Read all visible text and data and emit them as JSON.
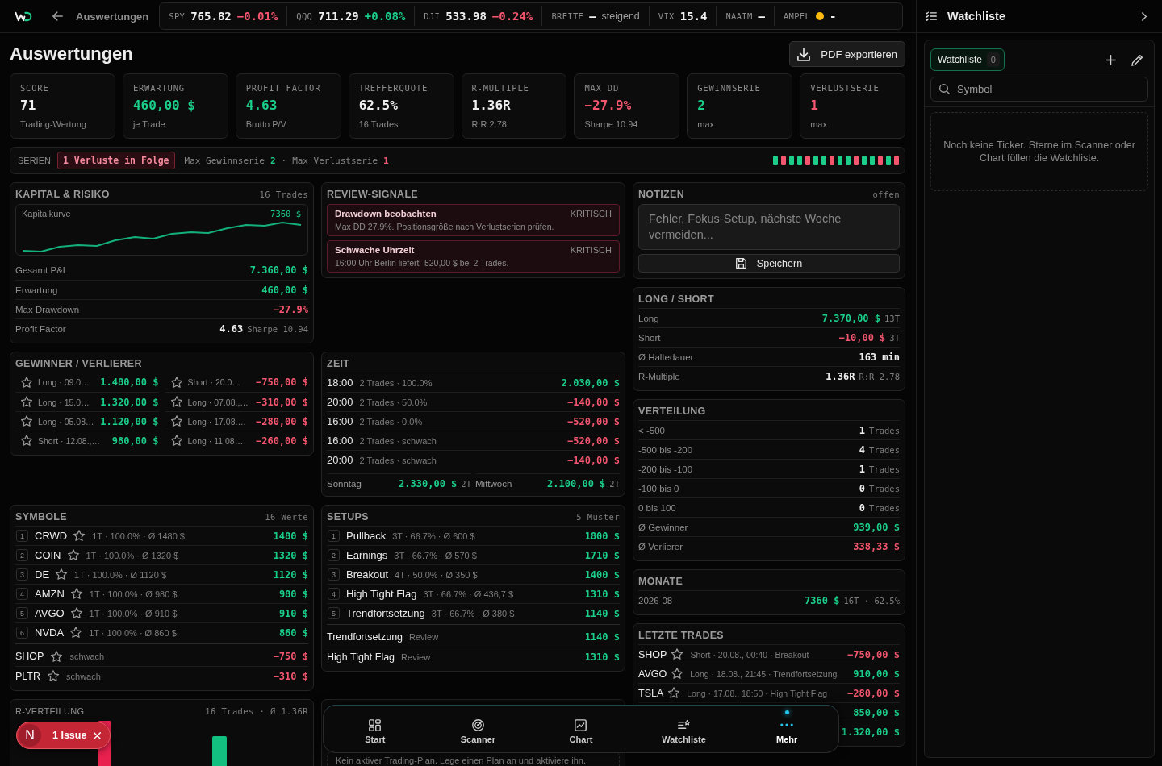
{
  "topbar": {
    "back_label": "Auswertungen",
    "tickers": [
      {
        "symbol": "SPY",
        "price": "765.82",
        "change": "−0.01%",
        "color": "#f5566f"
      },
      {
        "symbol": "QQQ",
        "price": "711.29",
        "change": "+0.08%",
        "color": "#1bcf8b"
      },
      {
        "symbol": "DJI",
        "price": "533.98",
        "change": "−0.24%",
        "color": "#f5566f"
      }
    ],
    "indicators": [
      {
        "label": "BREITE",
        "value": "–",
        "note": "steigend"
      },
      {
        "label": "VIX",
        "value": "15.4"
      },
      {
        "label": "NAAIM",
        "value": "–"
      },
      {
        "label": "AMPEL",
        "color": "#fdbb10",
        "value": "-"
      }
    ]
  },
  "header": {
    "title": "Auswertungen",
    "export_button": "PDF exportieren"
  },
  "kpis": [
    {
      "label": "SCORE",
      "value": "71",
      "color": "#eeeeee",
      "caption": "Trading-Wertung"
    },
    {
      "label": "ERWARTUNG",
      "value": "460,00 $",
      "color": "#1bcf8b",
      "caption": "je Trade"
    },
    {
      "label": "PROFIT FACTOR",
      "value": "4.63",
      "color": "#1bcf8b",
      "caption": "Brutto P/V"
    },
    {
      "label": "TREFFERQUOTE",
      "value": "62.5%",
      "color": "#eeeeee",
      "caption": "16 Trades"
    },
    {
      "label": "R-MULTIPLE",
      "value": "1.36R",
      "color": "#eeeeee",
      "caption": "R:R 2.78"
    },
    {
      "label": "MAX DD",
      "value": "−27.9%",
      "color": "#f5566f",
      "caption": "Sharpe 10.94"
    },
    {
      "label": "GEWINNSERIE",
      "value": "2",
      "color": "#1bcf8b",
      "caption": "max"
    },
    {
      "label": "VERLUSTSERIE",
      "value": "1",
      "color": "#f5566f",
      "caption": "max"
    }
  ],
  "series": {
    "label": "SERIEN",
    "badge": "1 Verluste in Folge",
    "stats": [
      {
        "label": "Max Gewinnserie",
        "value": "2",
        "color": "#1bcf8b"
      },
      {
        "label": "Max Verlustserie",
        "value": "1",
        "color": "#f5566f"
      }
    ],
    "separator": "·",
    "results": [
      {
        "color": "#1bcf8b"
      },
      {
        "color": "#f5566f"
      },
      {
        "color": "#1bcf8b"
      },
      {
        "color": "#1bcf8b"
      },
      {
        "color": "#f5566f"
      },
      {
        "color": "#1bcf8b"
      },
      {
        "color": "#1bcf8b"
      },
      {
        "color": "#f5566f"
      },
      {
        "color": "#1bcf8b"
      },
      {
        "color": "#1bcf8b"
      },
      {
        "color": "#f5566f"
      },
      {
        "color": "#1bcf8b"
      },
      {
        "color": "#1bcf8b"
      },
      {
        "color": "#f5566f"
      },
      {
        "color": "#1bcf8b"
      },
      {
        "color": "#f5566f"
      }
    ]
  },
  "capital": {
    "title": "KAPITAL & RISIKO",
    "meta": "16 Trades",
    "curve": {
      "label": "Kapitalkurve",
      "value": "7360 $"
    },
    "rows": [
      {
        "label": "Gesamt P&L",
        "value": "7.360,00 $",
        "color": "#1bcf8b"
      },
      {
        "label": "Erwartung",
        "value": "460,00 $",
        "color": "#1bcf8b"
      },
      {
        "label": "Max Drawdown",
        "value": "−27.9%",
        "color": "#f5566f"
      },
      {
        "label": "Profit Factor",
        "value": "4.63",
        "color": "#eeeeee",
        "note": "Sharpe 10.94"
      }
    ]
  },
  "review": {
    "title": "REVIEW-SIGNALE",
    "signals": [
      {
        "title": "Drawdown beobachten",
        "severity_label": "KRITISCH",
        "text": "Max DD 27.9%. Positionsgröße nach Verlustserien prüfen."
      },
      {
        "title": "Schwache Uhrzeit",
        "severity_label": "KRITISCH",
        "text": "16:00 Uhr Berlin liefert -520,00 $ bei 2 Trades."
      }
    ]
  },
  "notes": {
    "title": "NOTIZEN",
    "status": "offen",
    "placeholder": "Fehler, Fokus-Setup, nächste Woche vermeiden...",
    "save_button": "Speichern"
  },
  "long_short": {
    "title": "LONG / SHORT",
    "rows": [
      {
        "label": "Long",
        "value": "7.370,00 $",
        "color": "#1bcf8b",
        "note": "13T"
      },
      {
        "label": "Short",
        "value": "−10,00 $",
        "color": "#f5566f",
        "note": "3T"
      },
      {
        "label": "Ø Haltedauer",
        "value": "163 min",
        "color": "#eeeeee"
      },
      {
        "label": "R-Multiple",
        "value": "1.36R",
        "color": "#eeeeee",
        "note": "R:R 2.78"
      }
    ]
  },
  "winners_losers": {
    "title": "GEWINNER / VERLIERER",
    "winners": [
      {
        "detail": "Long · 09.0…",
        "value": "1.480,00 $",
        "color": "#1bcf8b"
      },
      {
        "detail": "Long · 15.0…",
        "value": "1.320,00 $",
        "color": "#1bcf8b"
      },
      {
        "detail": "Long · 05.08…",
        "value": "1.120,00 $",
        "color": "#1bcf8b"
      },
      {
        "detail": "Short · 12.08.,…",
        "value": "980,00 $",
        "color": "#1bcf8b"
      }
    ],
    "losers": [
      {
        "detail": "Short · 20.0…",
        "value": "−750,00 $",
        "color": "#f5566f"
      },
      {
        "detail": "Long · 07.08.,…",
        "value": "−310,00 $",
        "color": "#f5566f"
      },
      {
        "detail": "Long · 17.08.…",
        "value": "−280,00 $",
        "color": "#f5566f"
      },
      {
        "detail": "Long · 11.08…",
        "value": "−260,00 $",
        "color": "#f5566f"
      }
    ]
  },
  "time": {
    "title": "ZEIT",
    "rows": [
      {
        "time": "18:00",
        "detail": "2 Trades · 100.0%",
        "value": "2.030,00 $",
        "color": "#1bcf8b"
      },
      {
        "time": "20:00",
        "detail": "2 Trades · 50.0%",
        "value": "−140,00 $",
        "color": "#f5566f"
      },
      {
        "time": "16:00",
        "detail": "2 Trades · 0.0%",
        "value": "−520,00 $",
        "color": "#f5566f"
      },
      {
        "time": "16:00",
        "detail": "2 Trades · schwach",
        "value": "−520,00 $",
        "color": "#f5566f"
      },
      {
        "time": "20:00",
        "detail": "2 Trades · schwach",
        "value": "−140,00 $",
        "color": "#f5566f"
      }
    ],
    "weekdays": [
      {
        "day": "Sonntag",
        "value": "2.330,00 $",
        "color": "#1bcf8b",
        "count": "2T"
      },
      {
        "day": "Mittwoch",
        "value": "2.100,00 $",
        "color": "#1bcf8b",
        "count": "2T"
      }
    ]
  },
  "distribution": {
    "title": "VERTEILUNG",
    "rows": [
      {
        "label": "< -500",
        "value": "1",
        "color": "#eeeeee",
        "note": "Trades"
      },
      {
        "label": "-500 bis -200",
        "value": "4",
        "color": "#eeeeee",
        "note": "Trades"
      },
      {
        "label": "-200 bis -100",
        "value": "1",
        "color": "#eeeeee",
        "note": "Trades"
      },
      {
        "label": "-100 bis 0",
        "value": "0",
        "color": "#eeeeee",
        "note": "Trades"
      },
      {
        "label": "0 bis 100",
        "value": "0",
        "color": "#eeeeee",
        "note": "Trades"
      },
      {
        "label": "Ø Gewinner",
        "value": "939,00 $",
        "color": "#1bcf8b"
      },
      {
        "label": "Ø Verlierer",
        "value": "338,33 $",
        "color": "#f5566f"
      }
    ]
  },
  "months": {
    "title": "MONATE",
    "rows": [
      {
        "label": "2026-08",
        "value": "7360 $",
        "color": "#1bcf8b",
        "note": "16T · 62.5%"
      }
    ]
  },
  "symbols": {
    "title": "SYMBOLE",
    "meta": "16 Werte",
    "ranked": [
      {
        "rank": "1",
        "symbol": "CRWD",
        "detail": "1T · 100.0% · Ø 1480 $",
        "value": "1480 $",
        "color": "#1bcf8b"
      },
      {
        "rank": "2",
        "symbol": "COIN",
        "detail": "1T · 100.0% · Ø 1320 $",
        "value": "1320 $",
        "color": "#1bcf8b"
      },
      {
        "rank": "3",
        "symbol": "DE",
        "detail": "1T · 100.0% · Ø 1120 $",
        "value": "1120 $",
        "color": "#1bcf8b"
      },
      {
        "rank": "4",
        "symbol": "AMZN",
        "detail": "1T · 100.0% · Ø 980 $",
        "value": "980 $",
        "color": "#1bcf8b"
      },
      {
        "rank": "5",
        "symbol": "AVGO",
        "detail": "1T · 100.0% · Ø 910 $",
        "value": "910 $",
        "color": "#1bcf8b"
      },
      {
        "rank": "6",
        "symbol": "NVDA",
        "detail": "1T · 100.0% · Ø 860 $",
        "value": "860 $",
        "color": "#1bcf8b"
      }
    ],
    "weak": [
      {
        "symbol": "SHOP",
        "detail": "schwach",
        "value": "−750 $",
        "color": "#f5566f"
      },
      {
        "symbol": "PLTR",
        "detail": "schwach",
        "value": "−310 $",
        "color": "#f5566f"
      }
    ]
  },
  "setups": {
    "title": "SETUPS",
    "meta": "5 Muster",
    "ranked": [
      {
        "rank": "1",
        "name": "Pullback",
        "detail": "3T · 66.7% · Ø 600 $",
        "value": "1800 $",
        "color": "#1bcf8b"
      },
      {
        "rank": "2",
        "name": "Earnings",
        "detail": "3T · 66.7% · Ø 570 $",
        "value": "1710 $",
        "color": "#1bcf8b"
      },
      {
        "rank": "3",
        "name": "Breakout",
        "detail": "4T · 50.0% · Ø 350 $",
        "value": "1400 $",
        "color": "#1bcf8b"
      },
      {
        "rank": "4",
        "name": "High Tight Flag",
        "detail": "3T · 66.7% · Ø 436,7 $",
        "value": "1310 $",
        "color": "#1bcf8b"
      },
      {
        "rank": "5",
        "name": "Trendfortsetzung",
        "detail": "3T · 66.7% · Ø 380 $",
        "value": "1140 $",
        "color": "#1bcf8b"
      }
    ],
    "review": [
      {
        "name": "Trendfortsetzung",
        "detail": "Review",
        "value": "1140 $",
        "color": "#1bcf8b"
      },
      {
        "name": "High Tight Flag",
        "detail": "Review",
        "value": "1310 $",
        "color": "#1bcf8b"
      }
    ]
  },
  "recent_trades": {
    "title": "LETZTE TRADES",
    "rows": [
      {
        "symbol": "SHOP",
        "detail": "Short · 20.08., 00:40 · Breakout",
        "value": "−750,00 $",
        "color": "#f5566f"
      },
      {
        "symbol": "AVGO",
        "detail": "Long · 18.08., 21:45 · Trendfortsetzung",
        "value": "910,00 $",
        "color": "#1bcf8b"
      },
      {
        "symbol": "TSLA",
        "detail": "Long · 17.08., 18:50 · High Tight Flag",
        "value": "−280,00 $",
        "color": "#f5566f"
      },
      {
        "value": "850,00 $",
        "color": "#1bcf8b"
      },
      {
        "value": "1.320,00 $",
        "color": "#1bcf8b"
      }
    ]
  },
  "r_distribution": {
    "title": "R-VERTEILUNG",
    "meta": "16 Trades · Ø 1.36R"
  },
  "discipline": {
    "text": "Kein aktiver Trading-Plan. Lege einen Plan an und aktiviere ihn."
  },
  "bottom_nav": {
    "items": [
      {
        "kind": "grid",
        "label": "Start",
        "selected": false
      },
      {
        "kind": "radar",
        "label": "Scanner",
        "selected": false
      },
      {
        "kind": "chart",
        "label": "Chart",
        "selected": false
      },
      {
        "kind": "watchlist",
        "label": "Watchliste",
        "selected": false
      },
      {
        "kind": "more",
        "label": "Mehr",
        "selected": true
      }
    ]
  },
  "dev_badge": {
    "logo": "N",
    "label": "1 Issue"
  },
  "watchlist": {
    "title": "Watchliste",
    "tabs": [
      {
        "label": "Watchliste",
        "count": "0",
        "selected": true
      }
    ],
    "search": {
      "placeholder": "Symbol"
    },
    "empty_text": "Noch keine Ticker. Sterne im Scanner oder Chart füllen die Watchliste."
  }
}
